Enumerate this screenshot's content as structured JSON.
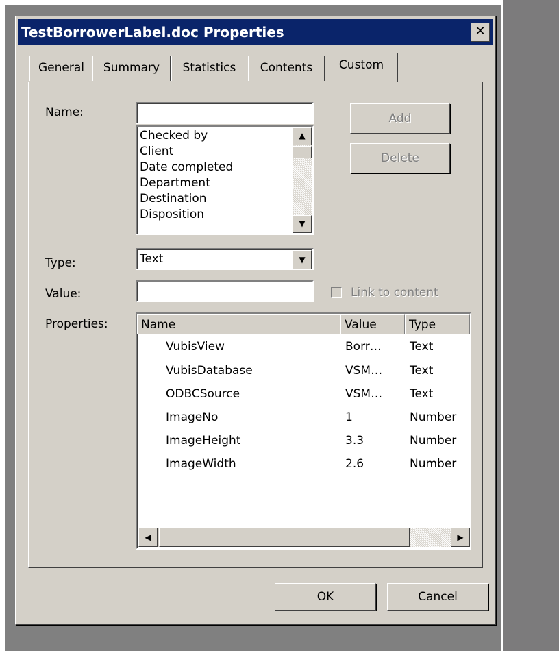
{
  "window": {
    "title": "TestBorrowerLabel.doc Properties",
    "close_glyph": "✕"
  },
  "tabs": [
    {
      "label": "General",
      "active": false
    },
    {
      "label": "Summary",
      "active": false
    },
    {
      "label": "Statistics",
      "active": false
    },
    {
      "label": "Contents",
      "active": false
    },
    {
      "label": "Custom",
      "active": true
    }
  ],
  "custom": {
    "name_label": "Name:",
    "name_value": "",
    "name_list": [
      "Checked by",
      "Client",
      "Date completed",
      "Department",
      "Destination",
      "Disposition"
    ],
    "add_label": "Add",
    "delete_label": "Delete",
    "type_label": "Type:",
    "type_value": "Text",
    "value_label": "Value:",
    "value_value": "",
    "link_label": "Link to content",
    "link_checked": false,
    "properties_label": "Properties:",
    "columns": [
      "Name",
      "Value",
      "Type"
    ],
    "rows": [
      {
        "name": "VubisView",
        "value": "Borr…",
        "type": "Text"
      },
      {
        "name": "VubisDatabase",
        "value": "VSM…",
        "type": "Text"
      },
      {
        "name": "ODBCSource",
        "value": "VSM…",
        "type": "Text"
      },
      {
        "name": "ImageNo",
        "value": "1",
        "type": "Number"
      },
      {
        "name": "ImageHeight",
        "value": "3.3",
        "type": "Number"
      },
      {
        "name": "ImageWidth",
        "value": "2.6",
        "type": "Number"
      }
    ]
  },
  "footer": {
    "ok_label": "OK",
    "cancel_label": "Cancel"
  },
  "icons": {
    "scroll_up": "up-arrow-icon",
    "scroll_down": "down-arrow-icon",
    "scroll_left": "left-arrow-icon",
    "scroll_right": "right-arrow-icon",
    "dropdown": "dropdown-arrow-icon"
  },
  "colors": {
    "titlebar": "#0a246a",
    "face": "#d4d0c8",
    "desktop": "#7c7b7c"
  }
}
